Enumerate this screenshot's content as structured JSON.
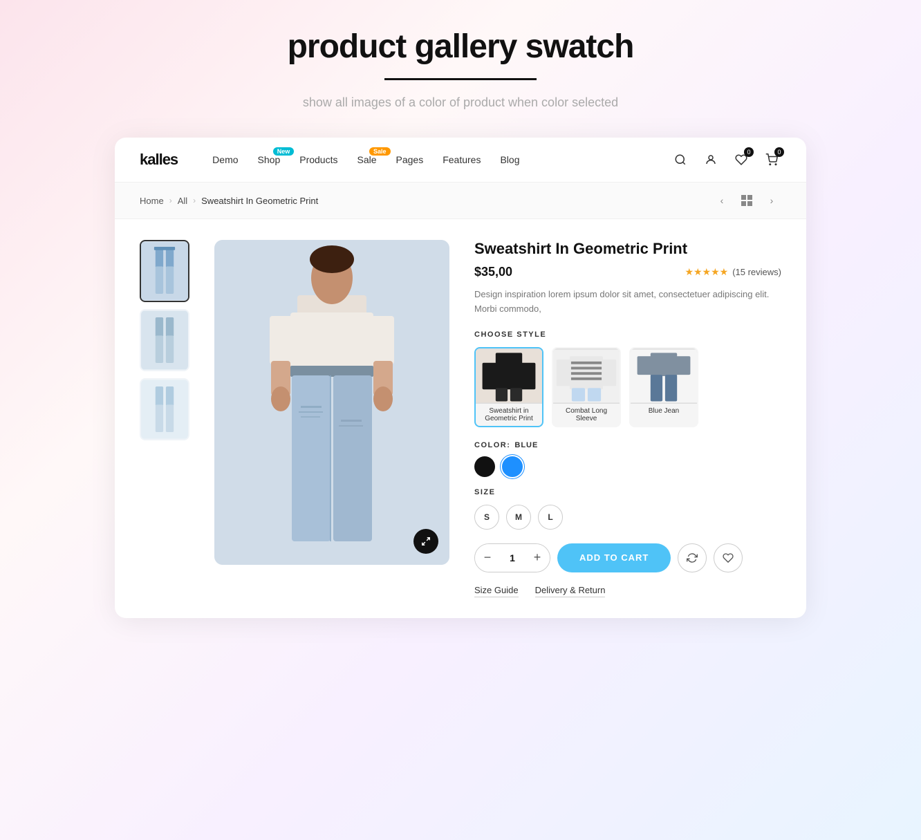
{
  "hero": {
    "title": "product gallery swatch",
    "subtitle": "show all images of a color of product when color selected"
  },
  "nav": {
    "logo": "kalles",
    "links": [
      {
        "label": "Demo",
        "badge": null
      },
      {
        "label": "Shop",
        "badge": "New",
        "badge_type": "new"
      },
      {
        "label": "Products",
        "badge": null
      },
      {
        "label": "Sale",
        "badge": "Sale",
        "badge_type": "sale"
      },
      {
        "label": "Pages",
        "badge": null
      },
      {
        "label": "Features",
        "badge": null
      },
      {
        "label": "Blog",
        "badge": null
      }
    ],
    "cart_count": "0",
    "wishlist_count": "0"
  },
  "breadcrumb": {
    "home": "Home",
    "all": "All",
    "current": "Sweatshirt In Geometric Print"
  },
  "product": {
    "title": "Sweatshirt In Geometric Print",
    "price": "$35,00",
    "rating": "★★★★★",
    "reviews": "(15 reviews)",
    "description": "Design inspiration lorem ipsum dolor sit amet, consectetuer adipiscing elit. Morbi commodo,",
    "style_label": "CHOOSE STYLE",
    "styles": [
      {
        "label": "Sweatshirt in Geometric Print"
      },
      {
        "label": "Combat Long Sleeve"
      },
      {
        "label": "Blue Jean"
      }
    ],
    "color_label": "COLOR:",
    "color_value": "BLUE",
    "size_label": "SIZE",
    "sizes": [
      "S",
      "M",
      "L"
    ],
    "quantity": "1",
    "add_to_cart": "ADD TO CART",
    "size_guide": "Size Guide",
    "delivery_return": "Delivery & Return"
  }
}
